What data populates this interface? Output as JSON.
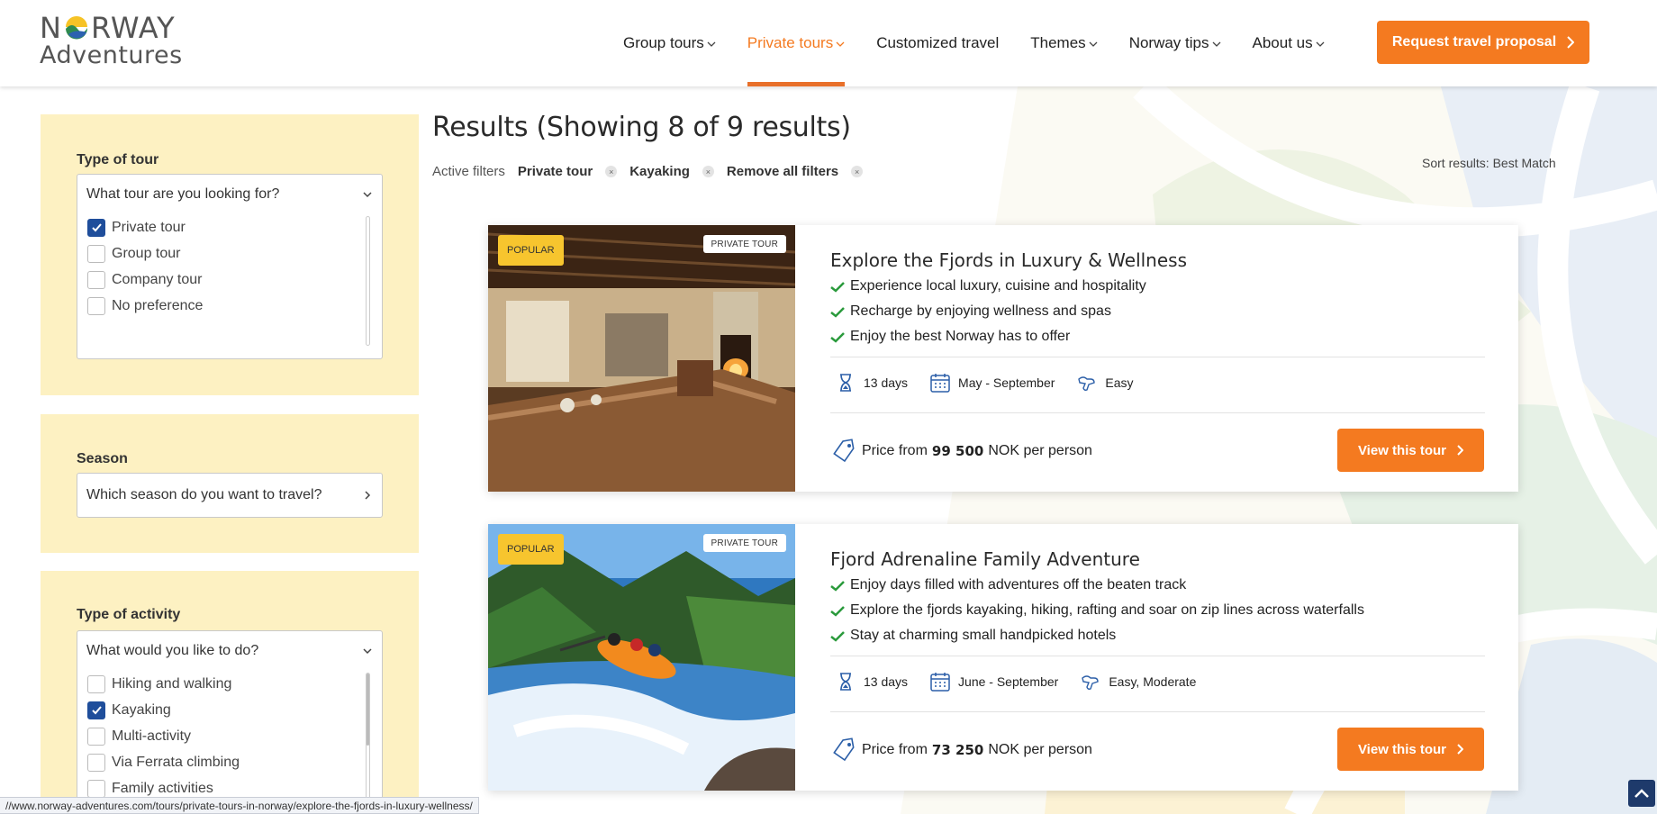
{
  "brand": {
    "name_top": "NORWAY",
    "name_top_pre": "N",
    "name_top_post": "RWAY",
    "name_bottom": "Adventures",
    "accent": "#f47a20"
  },
  "nav": {
    "items": [
      {
        "label": "Group tours",
        "dropdown": true
      },
      {
        "label": "Private tours",
        "dropdown": true,
        "active": true
      },
      {
        "label": "Customized travel",
        "dropdown": false
      },
      {
        "label": "Themes",
        "dropdown": true
      },
      {
        "label": "Norway tips",
        "dropdown": true
      },
      {
        "label": "About us",
        "dropdown": true
      }
    ],
    "cta_label": "Request travel proposal"
  },
  "sidebar": {
    "tour_type": {
      "title": "Type of tour",
      "placeholder": "What tour are you looking for?",
      "options": [
        {
          "label": "Private tour",
          "checked": true
        },
        {
          "label": "Group tour",
          "checked": false
        },
        {
          "label": "Company tour",
          "checked": false
        },
        {
          "label": "No preference",
          "checked": false
        }
      ]
    },
    "season": {
      "title": "Season",
      "placeholder": "Which season do you want to travel?"
    },
    "activity": {
      "title": "Type of activity",
      "placeholder": "What would you like to do?",
      "options": [
        {
          "label": "Hiking and walking",
          "checked": false
        },
        {
          "label": "Kayaking",
          "checked": true
        },
        {
          "label": "Multi-activity",
          "checked": false
        },
        {
          "label": "Via Ferrata climbing",
          "checked": false
        },
        {
          "label": "Family activities",
          "checked": false
        }
      ]
    }
  },
  "results": {
    "title": "Results (Showing 8 of 9 results)",
    "active_filters_label": "Active filters",
    "filters": [
      "Private tour",
      "Kayaking",
      "Remove all filters"
    ],
    "sort_label": "Sort results: Best Match"
  },
  "tours": [
    {
      "badge": "POPULAR",
      "type": "PRIVATE TOUR",
      "title": "Explore the Fjords in Luxury & Wellness",
      "highlights": [
        "Experience local luxury, cuisine and hospitality",
        "Recharge by enjoying wellness and spas",
        "Enjoy the best Norway has to offer"
      ],
      "duration": "13 days",
      "season": "May - September",
      "difficulty": "Easy",
      "price_prefix": "Price from",
      "price": "99 500",
      "price_suffix": "NOK per person",
      "button": "View this tour"
    },
    {
      "badge": "POPULAR",
      "type": "PRIVATE TOUR",
      "title": "Fjord Adrenaline Family Adventure",
      "highlights": [
        "Enjoy days filled with adventures off the beaten track",
        "Explore the fjords kayaking, hiking, rafting and soar on zip lines across waterfalls",
        "Stay at charming small handpicked hotels"
      ],
      "duration": "13 days",
      "season": "June - September",
      "difficulty": "Easy, Moderate",
      "price_prefix": "Price from",
      "price": "73 250",
      "price_suffix": "NOK per person",
      "button": "View this tour"
    }
  ],
  "status_url": "//www.norway-adventures.com/tours/private-tours-in-norway/explore-the-fjords-in-luxury-wellness/"
}
